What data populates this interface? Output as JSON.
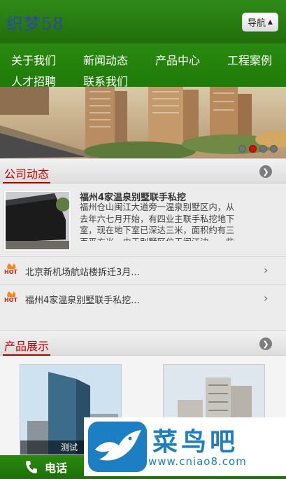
{
  "header": {
    "logo_text": "织梦58",
    "nav_button_label": "导航"
  },
  "menu": {
    "items": [
      {
        "label": "关于我们"
      },
      {
        "label": "新闻动态"
      },
      {
        "label": "产品中心"
      },
      {
        "label": "工程案例"
      },
      {
        "label": "人才招聘"
      },
      {
        "label": "联系我们"
      }
    ]
  },
  "banner": {
    "slide_count": 4,
    "active_slide": 2
  },
  "news_section": {
    "title": "公司动态",
    "featured": {
      "title": "福州4家温泉别墅联手私挖",
      "summary": "福州仓山闽江大道旁一温泉别墅区内，从去年六七月开始，有四业主联手私挖地下室，现在地下室已深达三米，面积约有三百平方米。由于别墅区位于闽江边，一些"
    },
    "items": [
      {
        "badge": "HOT",
        "text": "北京新机场航站楼拆迁3月..."
      },
      {
        "badge": "HOT",
        "text": "福州4家温泉别墅联手私挖..."
      }
    ]
  },
  "products_section": {
    "title": "产品展示",
    "items": [
      {
        "caption": "测试"
      },
      {
        "caption": ""
      }
    ]
  },
  "footer": {
    "phone_label": "电话"
  },
  "watermark": {
    "brand": "菜鸟吧",
    "url": "www.cniao8.com"
  },
  "colors": {
    "header_green": "#216e0c",
    "accent_red": "#c20000",
    "watermark_blue": "#1c7fc3"
  }
}
